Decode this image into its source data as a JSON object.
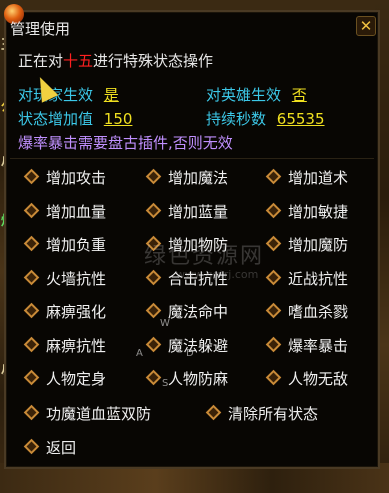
{
  "window": {
    "title": "管理使用",
    "close_icon": "close-icon"
  },
  "operation": {
    "prefix": "正在对",
    "target": "十五",
    "suffix": "进行特殊状态操作"
  },
  "settings": {
    "player_effect_label": "对玩家生效",
    "player_effect_value": "是",
    "hero_effect_label": "对英雄生效",
    "hero_effect_value": "否",
    "increase_label": "状态增加值",
    "increase_value": "150",
    "duration_label": "持续秒数",
    "duration_value": "65535"
  },
  "warning": "爆率暴击需要盘古插件,否则无效",
  "options": [
    "增加攻击",
    "增加魔法",
    "增加道术",
    "增加血量",
    "增加蓝量",
    "增加敏捷",
    "增加负重",
    "增加物防",
    "增加魔防",
    "火墙抗性",
    "合击抗性",
    "近战抗性",
    "麻痹强化",
    "魔法命中",
    "嗜血杀戮",
    "麻痹抗性",
    "魔法躲避",
    "爆率暴击",
    "人物定身",
    "人物防麻",
    "人物无敌"
  ],
  "bottom_options": [
    "功魔道血蓝双防",
    "清除所有状态"
  ],
  "back_label": "返回",
  "background_glyphs": [
    "王",
    "公",
    "尽",
    "烟",
    "尽"
  ],
  "watermark": {
    "main": "绿色资源网",
    "sub": "www.ggtrj.com"
  },
  "keys": [
    "W",
    "A",
    "D",
    "S"
  ],
  "colors": {
    "accent_yellow": "#f0e020",
    "cyan": "#3cc8e8",
    "warning_purple": "#c090ff",
    "target_red": "#ff2020",
    "diamond": "#c88a38"
  }
}
